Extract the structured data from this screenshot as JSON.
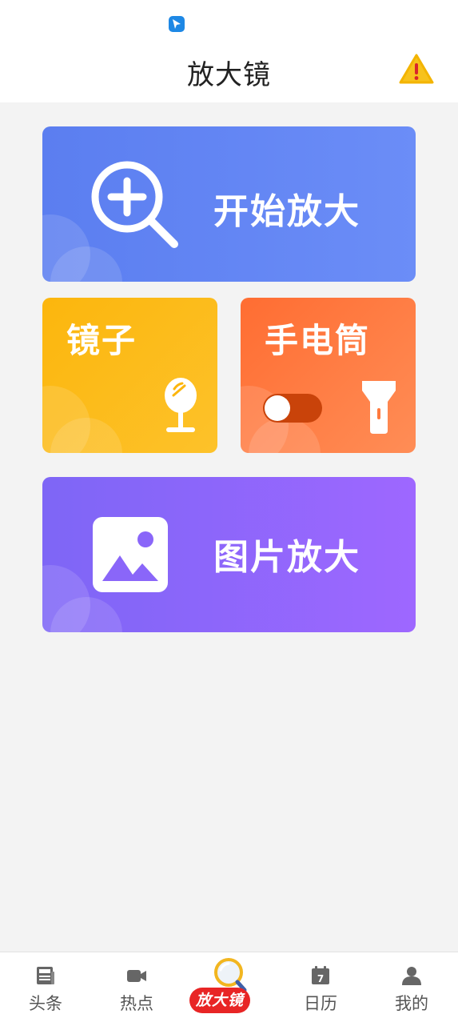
{
  "header": {
    "title": "放大镜"
  },
  "cards": {
    "zoom_label": "开始放大",
    "mirror_label": "镜子",
    "torch_label": "手电筒",
    "torch_on": false,
    "image_label": "图片放大"
  },
  "tabs": [
    {
      "label": "头条",
      "icon": "newspaper-icon"
    },
    {
      "label": "热点",
      "icon": "video-camera-icon"
    },
    {
      "label": "放大镜",
      "icon": "magnifier-icon",
      "active": true
    },
    {
      "label": "日历",
      "icon": "calendar-icon",
      "day": "7"
    },
    {
      "label": "我的",
      "icon": "person-icon"
    }
  ],
  "colors": {
    "zoom_card": "#5b7ef0",
    "mirror_card": "#fcb60d",
    "torch_card": "#ff6d32",
    "image_card": "#7e66f6",
    "badge": "#e82525"
  }
}
